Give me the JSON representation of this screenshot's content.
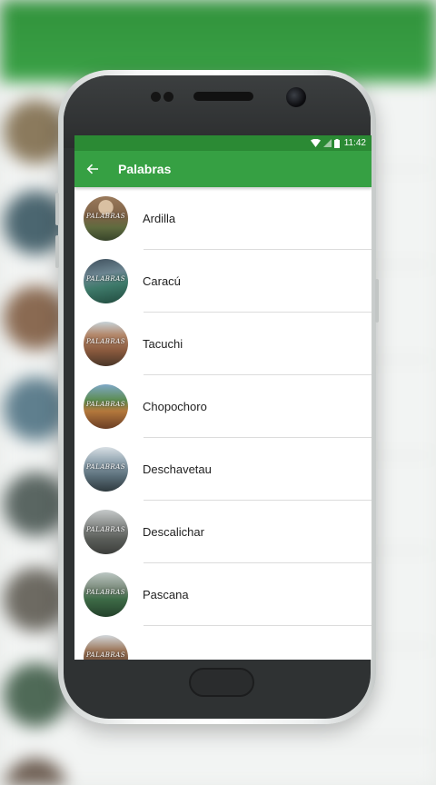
{
  "status_bar": {
    "time": "11:42"
  },
  "app_bar": {
    "title": "Palabras",
    "back_icon": "arrow-back-icon"
  },
  "thumbnail_text": "PALABRAS",
  "words": [
    {
      "label": "Ardilla"
    },
    {
      "label": "Caracú"
    },
    {
      "label": "Tacuchi"
    },
    {
      "label": "Chopochoro"
    },
    {
      "label": "Deschavetau"
    },
    {
      "label": "Descalichar"
    },
    {
      "label": "Pascana"
    },
    {
      "label": ""
    }
  ],
  "colors": {
    "status_bar": "#2b8a34",
    "app_bar": "#36a043"
  }
}
